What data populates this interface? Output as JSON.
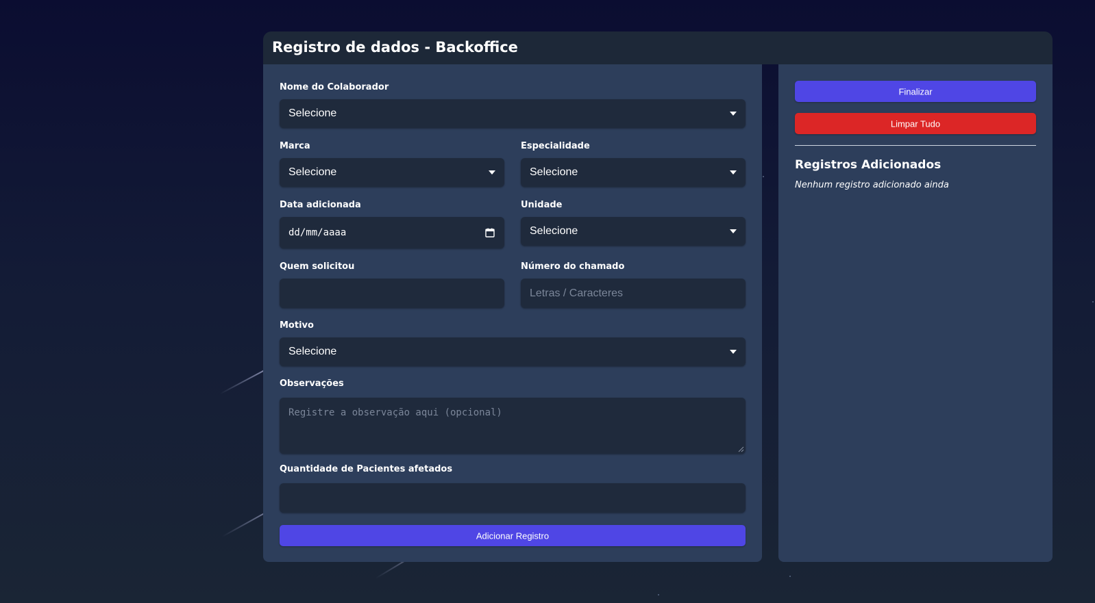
{
  "header": {
    "title": "Registro de dados - Backoffice"
  },
  "form": {
    "colaborador": {
      "label": "Nome do Colaborador",
      "value": "Selecione"
    },
    "marca": {
      "label": "Marca",
      "value": "Selecione"
    },
    "especialidade": {
      "label": "Especialidade",
      "value": "Selecione"
    },
    "data": {
      "label": "Data adicionada",
      "value": "dd/mm/aaaa"
    },
    "unidade": {
      "label": "Unidade",
      "value": "Selecione"
    },
    "quem_solicitou": {
      "label": "Quem solicitou",
      "value": ""
    },
    "numero_chamado": {
      "label": "Número do chamado",
      "placeholder": "Letras / Caracteres"
    },
    "motivo": {
      "label": "Motivo",
      "value": "Selecione"
    },
    "observacoes": {
      "label": "Observações",
      "placeholder": "Registre a observação aqui (opcional)"
    },
    "quantidade": {
      "label": "Quantidade de Pacientes afetados",
      "value": ""
    },
    "add_button": "Adicionar Registro"
  },
  "sidebar": {
    "finalizar_button": "Finalizar",
    "limpar_button": "Limpar Tudo",
    "title": "Registros Adicionados",
    "empty_message": "Nenhum registro adicionado ainda"
  },
  "colors": {
    "background": "#0b0d31",
    "panel": "#2d3e5b",
    "header": "#1d2838",
    "input": "#1f2a3c",
    "primary": "#4f46e5",
    "danger": "#dc2626"
  }
}
